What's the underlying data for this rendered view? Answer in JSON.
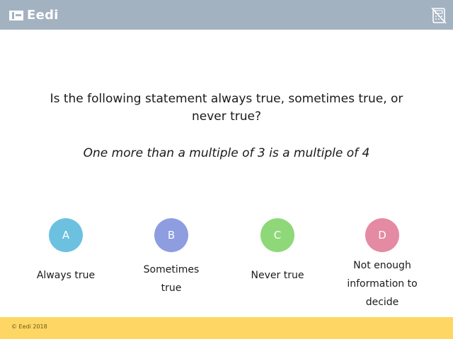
{
  "header": {
    "logo_text": "Eedi",
    "calculator_icon": "calculator-disabled-icon",
    "background": "#a3b2c1"
  },
  "question": {
    "prompt": "Is the following statement always true, sometimes true, or never true?",
    "statement": "One more than a multiple of 3 is a multiple of 4"
  },
  "answers": [
    {
      "letter": "A",
      "text": "Always true",
      "color": "#6cc1e0"
    },
    {
      "letter": "B",
      "text": "Sometimes true",
      "color": "#8e9ce0"
    },
    {
      "letter": "C",
      "text": "Never true",
      "color": "#8ed87a"
    },
    {
      "letter": "D",
      "text": "Not enough information to decide",
      "color": "#e58aa3"
    }
  ],
  "footer": {
    "copyright": "© Eedi 2018",
    "background": "#fdd663"
  }
}
